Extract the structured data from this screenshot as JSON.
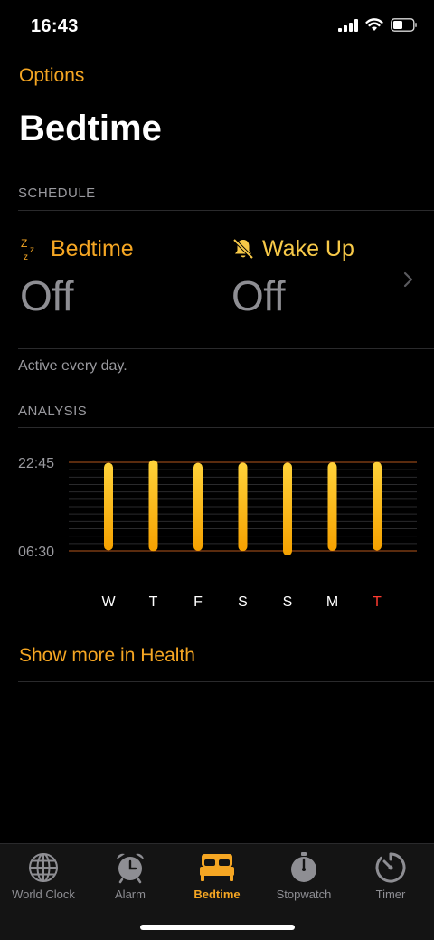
{
  "status_bar": {
    "time": "16:43"
  },
  "header": {
    "options_label": "Options",
    "title": "Bedtime"
  },
  "schedule": {
    "section_label": "SCHEDULE",
    "bedtime": {
      "label": "Bedtime",
      "value": "Off",
      "icon": "zzz-icon"
    },
    "wake_up": {
      "label": "Wake Up",
      "value": "Off",
      "icon": "bell-slash-icon"
    },
    "active_text": "Active every day."
  },
  "analysis": {
    "section_label": "ANALYSIS",
    "show_more_label": "Show more in Health"
  },
  "chart_data": {
    "type": "bar",
    "categories": [
      "W",
      "T",
      "F",
      "S",
      "S",
      "M",
      "T"
    ],
    "y_tick_labels": [
      "22:45",
      "06:30"
    ],
    "start": [
      22.8,
      22.55,
      22.8,
      22.78,
      22.78,
      22.75,
      22.72
    ],
    "end": [
      6.45,
      6.53,
      6.5,
      6.52,
      6.9,
      6.5,
      6.47
    ],
    "highlight_index": 6,
    "colors": {
      "bar_top": "#ffd23a",
      "bar_bottom": "#f5a100",
      "highlight_label": "#ff3b30",
      "grid": "#2a2a2c",
      "reference_line": "#b5561c"
    }
  },
  "tab_bar": {
    "tabs": [
      {
        "label": "World Clock",
        "icon": "globe-icon",
        "active": false
      },
      {
        "label": "Alarm",
        "icon": "alarm-clock-icon",
        "active": false
      },
      {
        "label": "Bedtime",
        "icon": "bed-icon",
        "active": true
      },
      {
        "label": "Stopwatch",
        "icon": "stopwatch-icon",
        "active": false
      },
      {
        "label": "Timer",
        "icon": "timer-icon",
        "active": false
      }
    ]
  },
  "colors": {
    "accent": "#f5a623",
    "wake_accent": "#f7c948",
    "muted": "#8e8e93",
    "background": "#000000"
  }
}
